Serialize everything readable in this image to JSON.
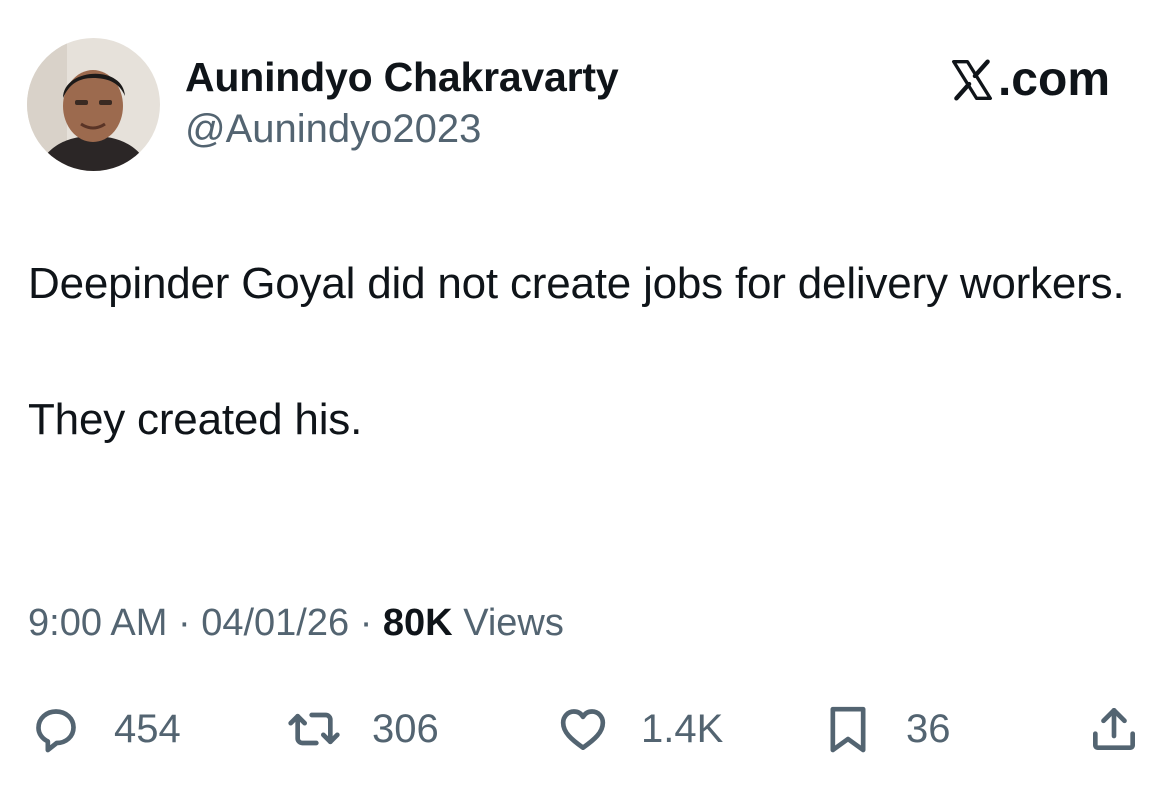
{
  "author": {
    "name": "Aunindyo Chakravarty",
    "handle": "@Aunindyo2023",
    "avatar_icon": "profile-photo"
  },
  "brand": {
    "icon": "x-logo-icon",
    "text": ".com"
  },
  "tweet": {
    "paragraphs": [
      "Deepinder Goyal did not create jobs for delivery workers.",
      "They created his."
    ]
  },
  "meta": {
    "time": "9:00 AM",
    "separator": "·",
    "date": "04/01/26",
    "views_count": "80K",
    "views_label": "Views"
  },
  "actions": {
    "reply": {
      "icon": "reply-icon",
      "count": "454"
    },
    "repost": {
      "icon": "repost-icon",
      "count": "306"
    },
    "like": {
      "icon": "heart-icon",
      "count": "1.4K"
    },
    "bookmark": {
      "icon": "bookmark-icon",
      "count": "36"
    },
    "share": {
      "icon": "share-icon"
    }
  },
  "colors": {
    "text_primary": "#0f1419",
    "text_secondary": "#536471",
    "background": "#ffffff"
  }
}
